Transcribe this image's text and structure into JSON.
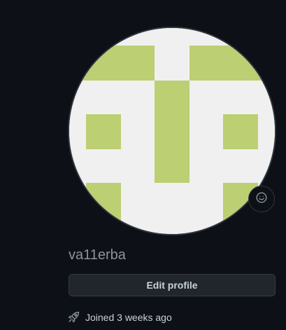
{
  "profile": {
    "username": "va11erba",
    "edit_label": "Edit profile",
    "joined_text": "Joined 3 weeks ago"
  },
  "avatar": {
    "type": "identicon",
    "foreground": "#bccf73",
    "background": "#f0f0f0"
  },
  "icons": {
    "status": "smiley-icon",
    "joined": "rocket-icon"
  },
  "colors": {
    "page_background": "#0d1117",
    "muted_text": "#8b949e",
    "text": "#c9d1d9",
    "button_background": "#21262d",
    "border": "#30363d"
  }
}
